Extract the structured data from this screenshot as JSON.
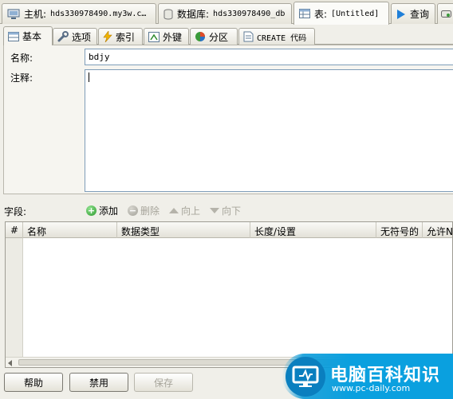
{
  "doc_tabs": [
    {
      "name": "主机:",
      "value": "hds330978490.my3w.c…"
    },
    {
      "name": "数据库:",
      "value": "hds330978490_db"
    },
    {
      "name": "表:",
      "value": "[Untitled]"
    },
    {
      "name": "查询",
      "value": ""
    }
  ],
  "inner_tabs": [
    "基本",
    "选项",
    "索引",
    "外键",
    "分区",
    "CREATE 代码"
  ],
  "form": {
    "name_label": "名称:",
    "name_value": "bdjy",
    "comment_label": "注释:",
    "comment_value": ""
  },
  "fields": {
    "label": "字段:",
    "add": "添加",
    "delete": "删除",
    "up": "向上",
    "down": "向下"
  },
  "columns": [
    "#",
    "名称",
    "数据类型",
    "长度/设置",
    "无符号的",
    "允许N"
  ],
  "buttons": {
    "help": "帮助",
    "disable": "禁用",
    "save": "保存"
  },
  "watermark": {
    "text": "电脑百科知识",
    "url": "www.pc-daily.com"
  },
  "colors": {
    "accent": "#0aa0df",
    "input_border": "#7f9db9",
    "panel_bg": "#f0efe9"
  }
}
